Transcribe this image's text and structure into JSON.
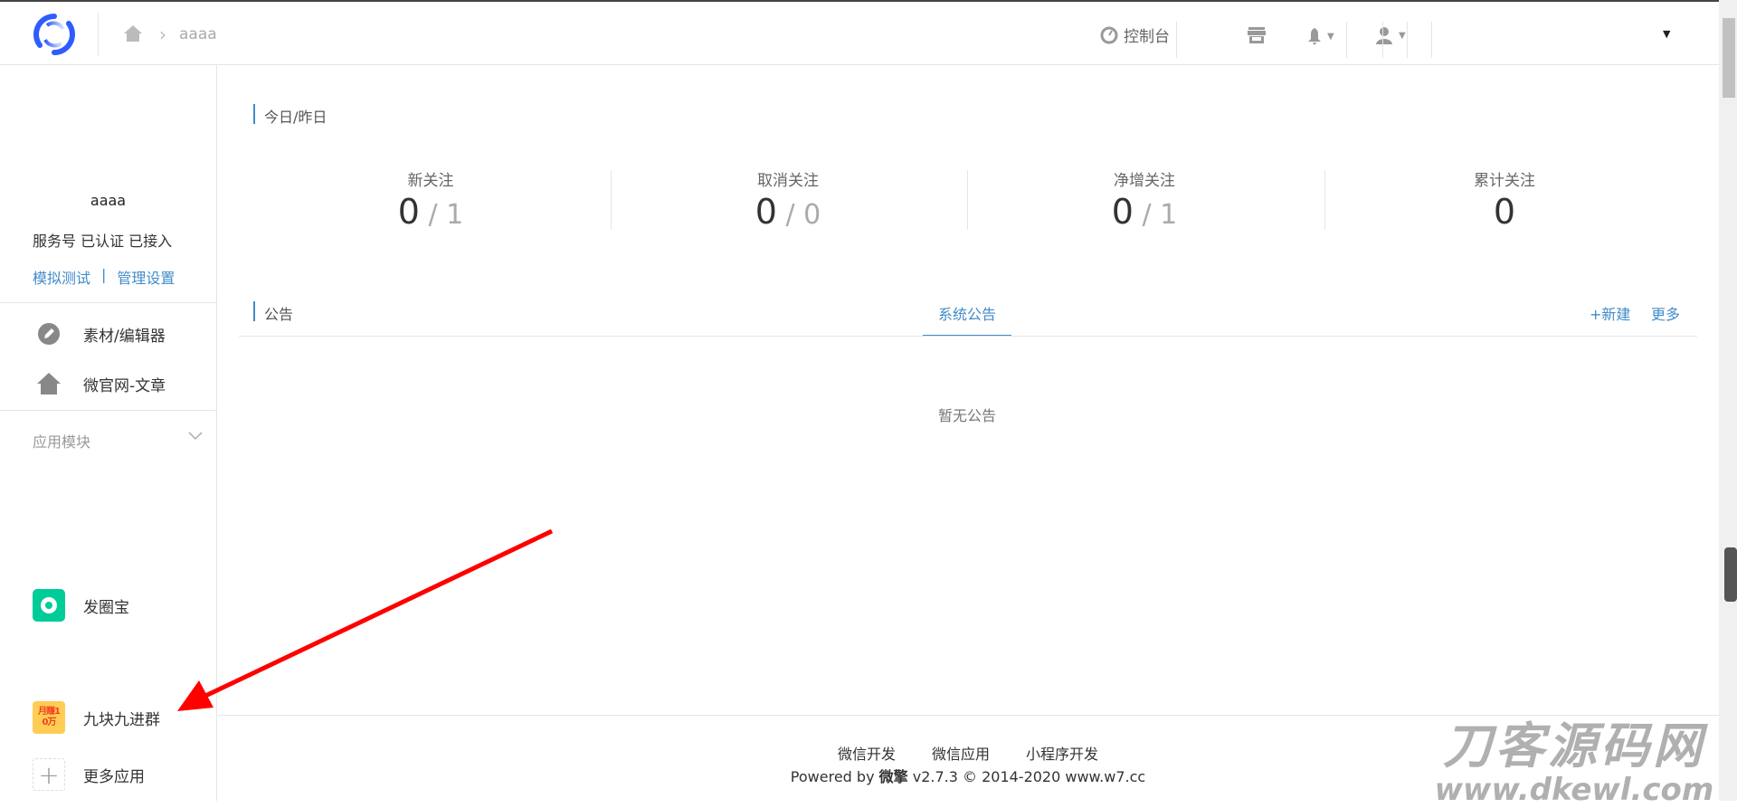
{
  "header": {
    "breadcrumb_current": "aaaa",
    "console_label": "控制台"
  },
  "sidebar": {
    "account_name": "aaaa",
    "account_status": "服务号 已认证 已接入",
    "link_test": "模拟测试",
    "link_sep": "|",
    "link_settings": "管理设置",
    "items": [
      {
        "label": "素材/编辑器"
      },
      {
        "label": "微官网-文章"
      }
    ],
    "module_title": "应用模块",
    "apps": [
      {
        "label": "发圈宝"
      },
      {
        "label": "九块九进群",
        "icon_text": "月赚10万"
      },
      {
        "label": "更多应用"
      }
    ]
  },
  "main": {
    "today_title": "今日/昨日",
    "stats": [
      {
        "label": "新关注",
        "today": "0",
        "yesterday": "1"
      },
      {
        "label": "取消关注",
        "today": "0",
        "yesterday": "0"
      },
      {
        "label": "净增关注",
        "today": "0",
        "yesterday": "1"
      },
      {
        "label": "累计关注",
        "today": "0"
      }
    ],
    "notice_title": "公告",
    "notice_tab": "系统公告",
    "new_label": "+新建",
    "more_label": "更多",
    "empty_text": "暂无公告"
  },
  "footer": {
    "links": [
      "微信开发",
      "微信应用",
      "小程序开发"
    ],
    "powered_prefix": "Powered by ",
    "brand": "微擎",
    "powered_suffix": " v2.7.3 © 2014-2020 www.w7.cc"
  },
  "watermark": {
    "title": "刀客源码网",
    "url": "www.dkewl.com"
  },
  "colors": {
    "accent": "#428bca",
    "annotation_arrow": "#ff0000"
  }
}
